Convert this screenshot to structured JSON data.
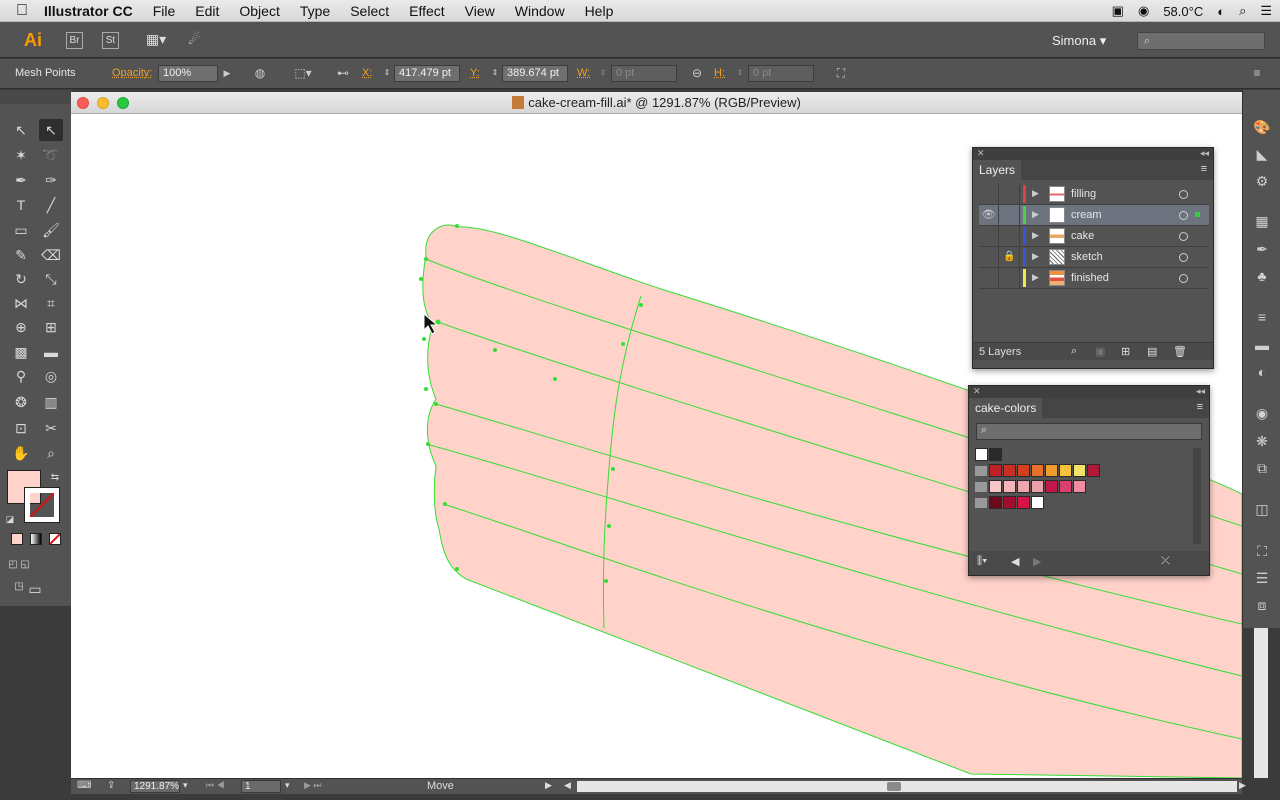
{
  "menubar": {
    "app_name": "Illustrator CC",
    "items": [
      "File",
      "Edit",
      "Object",
      "Type",
      "Select",
      "Effect",
      "View",
      "Window",
      "Help"
    ],
    "temperature": "58.0°C"
  },
  "appbar": {
    "logo": "Ai",
    "bridge": "Br",
    "stock": "St",
    "user": "Simona"
  },
  "controlbar": {
    "selection_label": "Mesh Points",
    "opacity_label": "Opacity:",
    "opacity_value": "100%",
    "x_label": "X:",
    "x_value": "417.479 pt",
    "y_label": "Y:",
    "y_value": "389.674 pt",
    "w_label": "W:",
    "w_value": "0 pt",
    "h_label": "H:",
    "h_value": "0 pt"
  },
  "document": {
    "title": "cake-cream-fill.ai* @ 1291.87% (RGB/Preview)",
    "zoom": "1291.87%",
    "artboard": "1",
    "status": "Move",
    "fill_color": "#ffd2ca",
    "mesh_color": "#33dd33"
  },
  "layers_panel": {
    "tab": "Layers",
    "layers": [
      {
        "name": "filling",
        "color": "#e0404a",
        "visible": false,
        "locked": false,
        "selected": false
      },
      {
        "name": "cream",
        "color": "#4ad04a",
        "visible": true,
        "locked": false,
        "selected": true
      },
      {
        "name": "cake",
        "color": "#3a52e0",
        "visible": false,
        "locked": false,
        "selected": false
      },
      {
        "name": "sketch",
        "color": "#3a52e0",
        "visible": false,
        "locked": true,
        "selected": false
      },
      {
        "name": "finished",
        "color": "#f2e84a",
        "visible": false,
        "locked": false,
        "selected": false
      }
    ],
    "count": "5 Layers"
  },
  "swatches_panel": {
    "tab": "cake-colors",
    "rows": [
      [
        "#ffffff",
        "#2a2a2a"
      ],
      [
        "#c0202a",
        "#c82e22",
        "#d4401e",
        "#e8702a",
        "#f09a30",
        "#f5c23a",
        "#f2e468",
        "#b01838"
      ],
      [
        "#f6c8c8",
        "#f4b4b8",
        "#f0a6ac",
        "#eaa0a6",
        "#c01848",
        "#d84070",
        "#f08ca0"
      ],
      [
        "#6a0a1a",
        "#a00e2e",
        "#d81446",
        "#ffffff"
      ]
    ]
  }
}
